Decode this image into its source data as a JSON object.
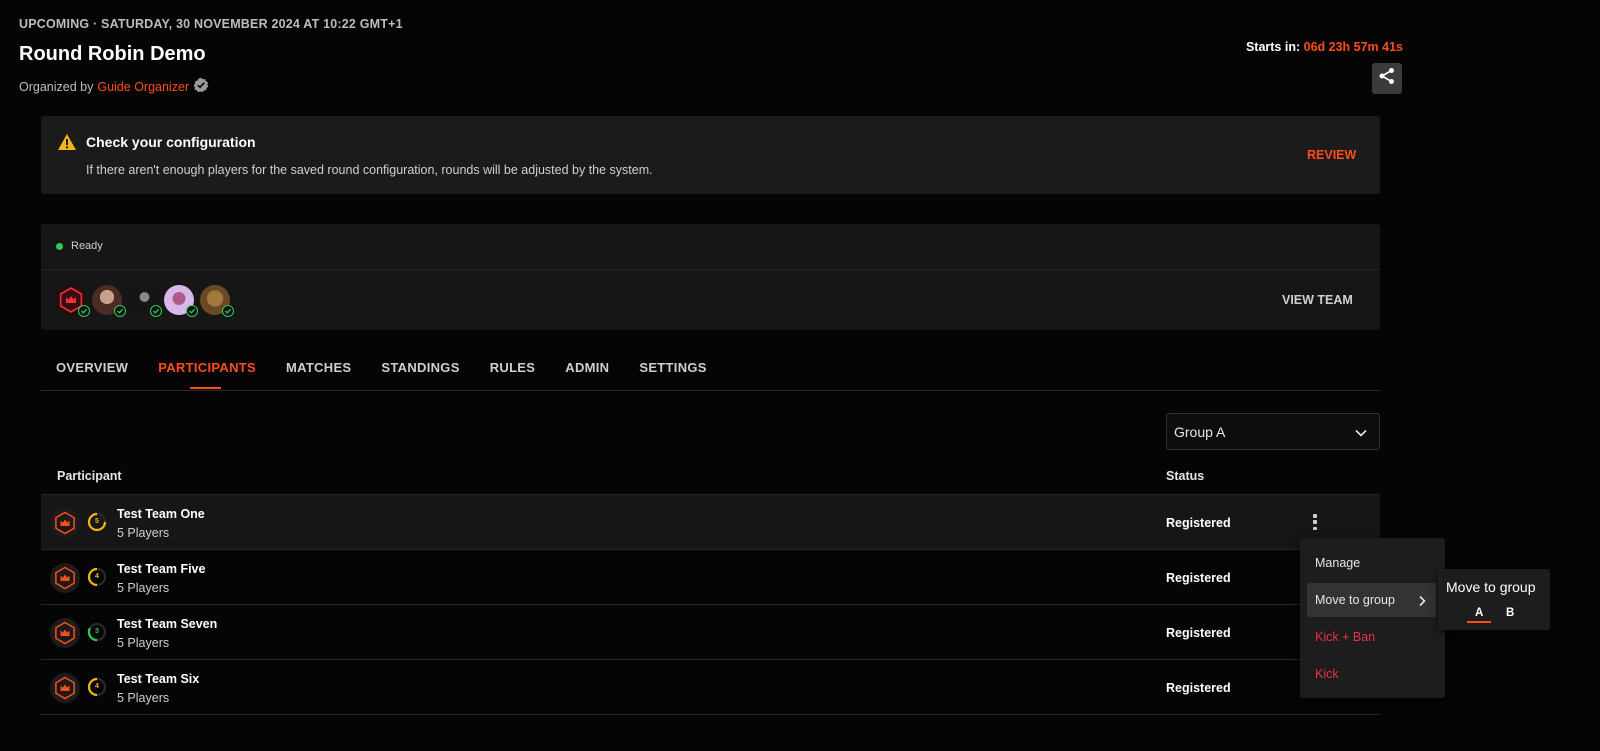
{
  "header": {
    "status_line": "UPCOMING · SATURDAY, 30 NOVEMBER 2024 AT 10:22 GMT+1",
    "title": "Round Robin Demo",
    "organized_by_label": "Organized by",
    "organizer": "Guide Organizer",
    "starts_in_label": "Starts in:",
    "countdown": "06d 23h 57m 41s"
  },
  "alert": {
    "title": "Check your configuration",
    "text": "If there aren't enough players for the saved round configuration, rounds will be adjusted by the system.",
    "action": "REVIEW"
  },
  "team": {
    "status": "Ready",
    "view_label": "VIEW TEAM",
    "members": [
      "team-logo",
      "player-2",
      "player-3",
      "player-4",
      "player-5"
    ]
  },
  "tabs": [
    "OVERVIEW",
    "PARTICIPANTS",
    "MATCHES",
    "STANDINGS",
    "RULES",
    "ADMIN",
    "SETTINGS"
  ],
  "active_tab": "PARTICIPANTS",
  "group_select": {
    "value": "Group A"
  },
  "table": {
    "col_participant": "Participant",
    "col_status": "Status",
    "rows": [
      {
        "name": "Test Team One",
        "players": "5 Players",
        "status": "Registered",
        "rank": "5",
        "rank_color": "#f2b713"
      },
      {
        "name": "Test Team Five",
        "players": "5 Players",
        "status": "Registered",
        "rank": "4",
        "rank_color": "#f2b713"
      },
      {
        "name": "Test Team Seven",
        "players": "5 Players",
        "status": "Registered",
        "rank": "3",
        "rank_color": "#2ecc57"
      },
      {
        "name": "Test Team Six",
        "players": "5 Players",
        "status": "Registered",
        "rank": "4",
        "rank_color": "#f2b713"
      }
    ]
  },
  "context_menu": {
    "items": [
      "Manage",
      "Move to group",
      "Kick + Ban",
      "Kick"
    ],
    "submenu_title": "Move to group",
    "submenu_options": [
      "A",
      "B"
    ],
    "selected_option": "A"
  },
  "colors": {
    "accent": "#ff4d1a",
    "ready": "#2ecc57",
    "danger": "#e8323e",
    "warning": "#f2b713"
  }
}
